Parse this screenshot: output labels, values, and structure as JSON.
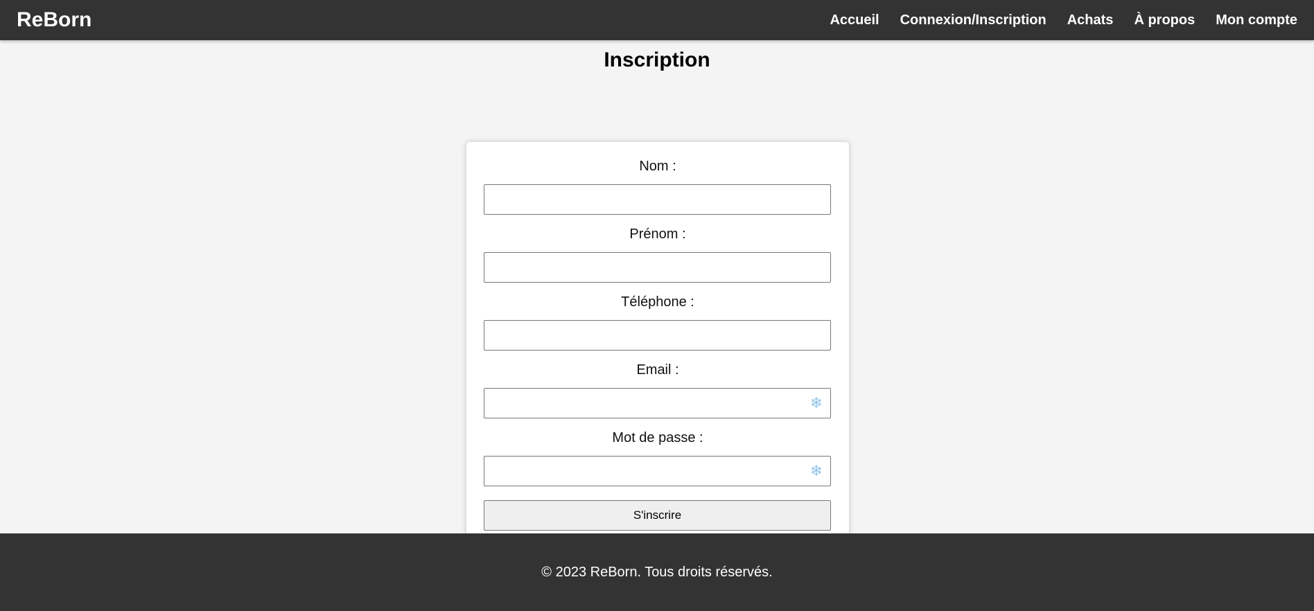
{
  "header": {
    "logo": "ReBorn",
    "nav": [
      "Accueil",
      "Connexion/Inscription",
      "Achats",
      "À propos",
      "Mon compte"
    ]
  },
  "page": {
    "title": "Inscription"
  },
  "form": {
    "fields": [
      {
        "label": "Nom :",
        "value": "",
        "autofill_icon": false
      },
      {
        "label": "Prénom :",
        "value": "",
        "autofill_icon": false
      },
      {
        "label": "Téléphone :",
        "value": "",
        "autofill_icon": false
      },
      {
        "label": "Email :",
        "value": "",
        "autofill_icon": true
      },
      {
        "label": "Mot de passe :",
        "value": "",
        "autofill_icon": true
      }
    ],
    "submit_label": "S'inscrire"
  },
  "footer": {
    "text": "© 2023 ReBorn. Tous droits réservés."
  },
  "colors": {
    "header_bg": "#333333",
    "page_bg": "#f4f4f4",
    "card_bg": "#ffffff",
    "button_bg": "#efefef",
    "autofill_icon": "#8fc4e8"
  }
}
